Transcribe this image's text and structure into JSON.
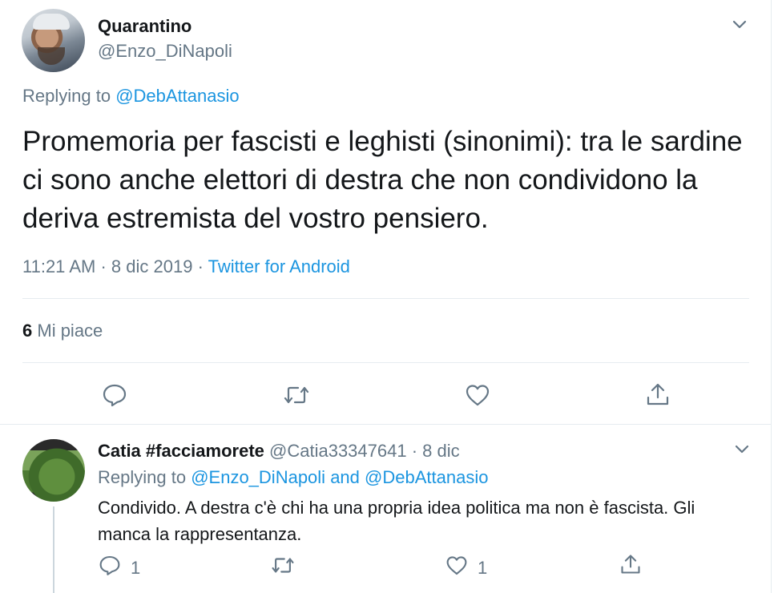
{
  "tweet": {
    "display_name": "Quarantino",
    "handle": "@Enzo_DiNapoli",
    "replying_prefix": "Replying to",
    "replying_to": "@DebAttanasio",
    "text": "Promemoria per fascisti e leghisti (sinonimi): tra le sardine ci sono anche elettori di destra che non condividono la deriva estremista del vostro pensiero.",
    "time": "11:21 AM",
    "date": "8 dic 2019",
    "separator": "·",
    "source": "Twitter for Android",
    "likes_count": "6",
    "likes_label": "Mi piace"
  },
  "reply": {
    "display_name": "Catia #facciamorete",
    "handle": "@Catia33347641",
    "separator": "·",
    "date": "8 dic",
    "replying_prefix": "Replying to",
    "replying_to_1": "@Enzo_DiNapoli",
    "replying_and": "and",
    "replying_to_2": "@DebAttanasio",
    "text": "Condivido.  A destra c'è chi ha una propria idea politica ma non è fascista. Gli manca la rappresentanza.",
    "reply_count": "1",
    "like_count": "1"
  },
  "icons": {
    "more": "chevron-down-icon",
    "reply": "reply-icon",
    "retweet": "retweet-icon",
    "like": "heart-icon",
    "share": "share-icon"
  },
  "colors": {
    "link": "#1b95e0",
    "secondary_text": "#657786",
    "primary_text": "#14171a",
    "divider": "#e6ecf0"
  }
}
